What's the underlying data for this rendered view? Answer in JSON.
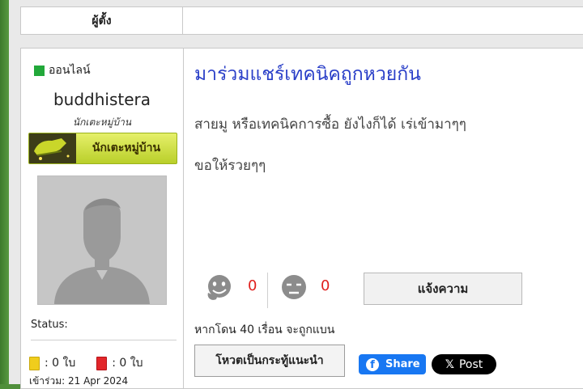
{
  "header": {
    "left_label": "ผู้ตั้ง"
  },
  "user": {
    "online_text": "ออนไลน์",
    "username": "buddhistera",
    "rank": "นักเตะหมู่บ้าน",
    "badge_text": "นักเตะหมู่บ้าน",
    "status_label": "Status:",
    "yellow_cards": ": 0 ใบ",
    "red_cards": ": 0 ใบ",
    "joined": "เข้าร่วม: 21 Apr 2024"
  },
  "post": {
    "title": "มาร่วมแชร์เทคนิคถูกหวยกัน",
    "paragraph1": "สายมู หรือเทคนิคการซื้อ ยังไงก็ได้ เร่เข้ามาๆๆ",
    "paragraph2": "ขอให้รวยๆๆ"
  },
  "reactions": {
    "like_count": "0",
    "dislike_count": "0"
  },
  "actions": {
    "report_label": "แจ้งความ",
    "ban_warning": "หากโดน 40 เรื่อน จะถูกแบน",
    "recommend_label": "โหวตเป็นกระทู้แนะนำ",
    "share_label": "Share",
    "post_label": "Post"
  },
  "colors": {
    "online": "#22a83a",
    "title": "#2a3fc8",
    "count": "#e0201e",
    "facebook": "#1877f2"
  }
}
